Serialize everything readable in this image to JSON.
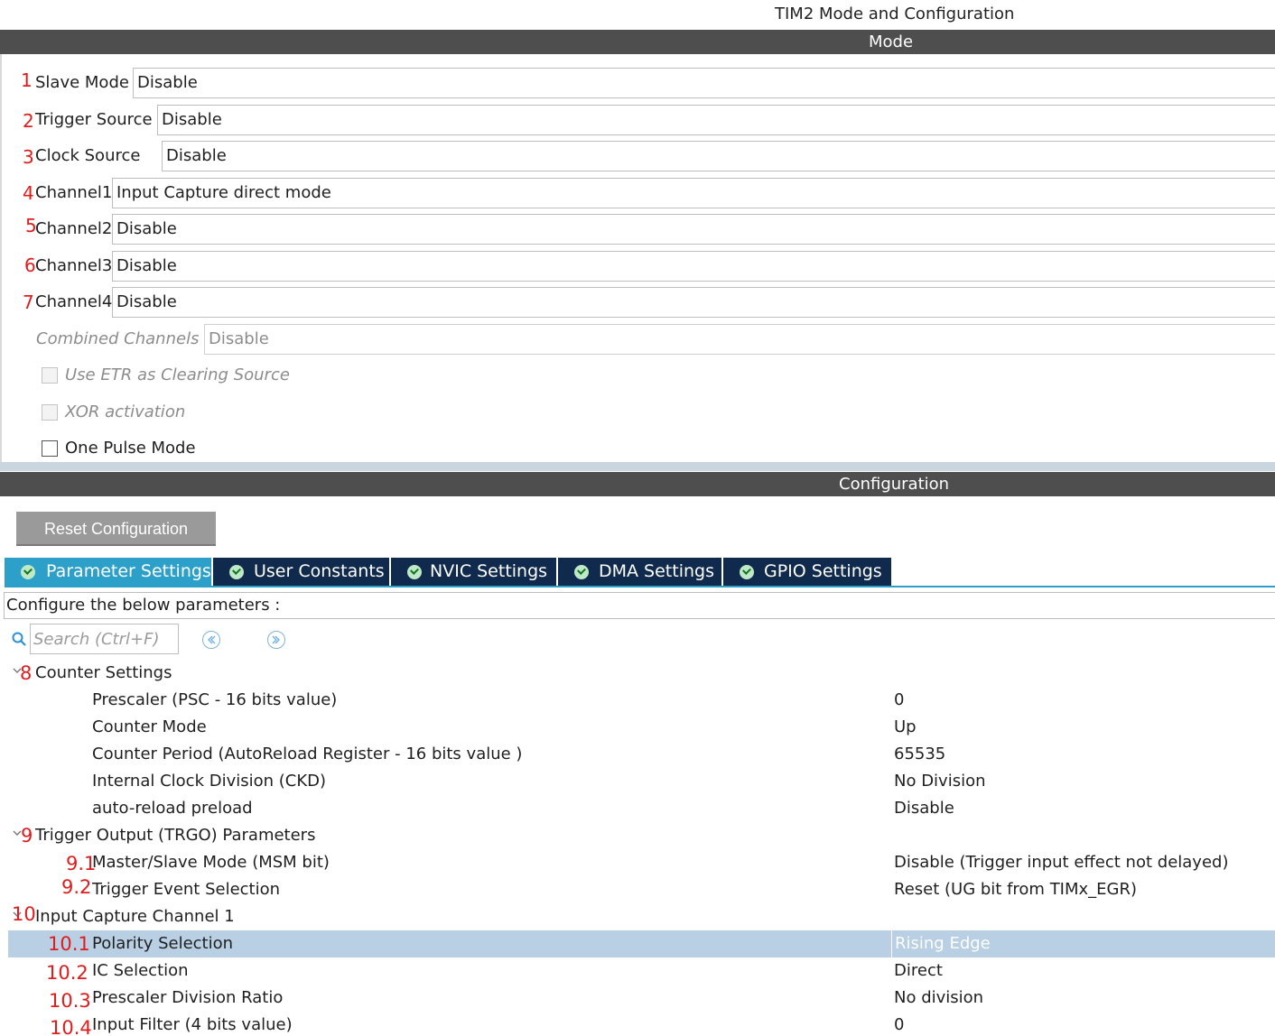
{
  "window": {
    "title": "TIM2 Mode and Configuration"
  },
  "mode": {
    "header": "Mode",
    "rows": [
      {
        "num": "1",
        "label": "Slave Mode",
        "value": "Disable"
      },
      {
        "num": "2",
        "label": "Trigger Source",
        "value": "Disable"
      },
      {
        "num": "3",
        "label": "Clock Source",
        "value": "Disable"
      },
      {
        "num": "4",
        "label": "Channel1",
        "value": "Input Capture direct mode"
      },
      {
        "num": "5",
        "label": "Channel2",
        "value": "Disable"
      },
      {
        "num": "6",
        "label": "Channel3",
        "value": "Disable"
      },
      {
        "num": "7",
        "label": "Channel4",
        "value": "Disable"
      }
    ],
    "combined_channels": {
      "label": "Combined Channels",
      "value": "Disable"
    },
    "checkboxes": [
      {
        "label": "Use ETR as Clearing Source",
        "checked": false,
        "enabled": false
      },
      {
        "label": "XOR activation",
        "checked": false,
        "enabled": false
      },
      {
        "label": "One Pulse Mode",
        "checked": false,
        "enabled": true
      }
    ]
  },
  "configuration": {
    "header": "Configuration",
    "reset_button": "Reset Configuration",
    "tabs": [
      {
        "label": "Parameter Settings",
        "active": true
      },
      {
        "label": "User Constants",
        "active": false
      },
      {
        "label": "NVIC Settings",
        "active": false
      },
      {
        "label": "DMA Settings",
        "active": false
      },
      {
        "label": "GPIO Settings",
        "active": false
      }
    ],
    "instructions": "Configure the below parameters :",
    "search": {
      "placeholder": "Search (Ctrl+F)",
      "value": ""
    },
    "groups": [
      {
        "num": "8",
        "label": "Counter Settings",
        "params": [
          {
            "num": "",
            "label": "Prescaler (PSC - 16 bits value)",
            "value": "0"
          },
          {
            "num": "",
            "label": "Counter Mode",
            "value": "Up"
          },
          {
            "num": "",
            "label": "Counter Period (AutoReload Register - 16 bits value )",
            "value": "65535"
          },
          {
            "num": "",
            "label": "Internal Clock Division (CKD)",
            "value": "No Division"
          },
          {
            "num": "",
            "label": "auto-reload preload",
            "value": "Disable"
          }
        ]
      },
      {
        "num": "9",
        "label": "Trigger Output (TRGO) Parameters",
        "params": [
          {
            "num": "9.1",
            "label": "Master/Slave Mode (MSM bit)",
            "value": "Disable (Trigger input effect not delayed)"
          },
          {
            "num": "9.2",
            "label": "Trigger Event Selection",
            "value": "Reset (UG bit from TIMx_EGR)"
          }
        ]
      },
      {
        "num": "10",
        "label": "Input Capture Channel 1",
        "params": [
          {
            "num": "10.1",
            "label": "Polarity Selection",
            "value": "Rising Edge",
            "selected": true
          },
          {
            "num": "10.2",
            "label": "IC Selection",
            "value": "Direct"
          },
          {
            "num": "10.3",
            "label": "Prescaler Division Ratio",
            "value": "No division"
          },
          {
            "num": "10.4",
            "label": "Input Filter (4 bits value)",
            "value": "0"
          }
        ]
      }
    ]
  },
  "colors": {
    "header_bar": "#4e4e4e",
    "tab_active": "#2ca0c8",
    "tab_inactive": "#0f2a4d",
    "selected_row": "#b8cfe4",
    "annotation_red": "#e01c1c"
  }
}
